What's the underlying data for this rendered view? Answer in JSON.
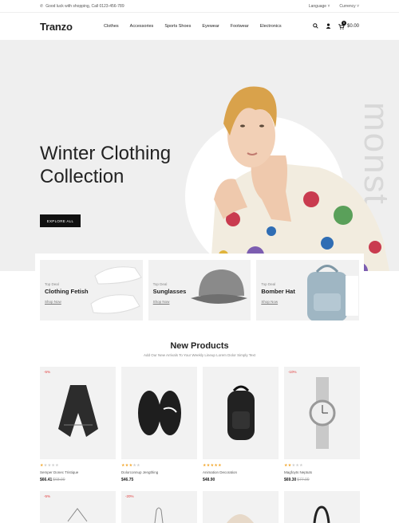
{
  "topbar": {
    "phone_icon": "phone-icon",
    "message": "Good luck with shopping, Call 0123-456-789",
    "language": "Language",
    "currency": "Currency"
  },
  "header": {
    "logo": "Tranzo",
    "nav": [
      "Clothes",
      "Accessories",
      "Sports Shoes",
      "Eyewear",
      "Footwear",
      "Electronics"
    ],
    "cart_total": "$0.00",
    "cart_count": "0"
  },
  "hero": {
    "title_line1": "Winter Clothing",
    "title_line2": "Collection",
    "button": "EXPLORE ALL",
    "vertical_text": "monst"
  },
  "promos": [
    {
      "tag": "Top Deal",
      "title": "Clothing Fetish",
      "link": "Shop Now"
    },
    {
      "tag": "Top Deal",
      "title": "Sunglasses",
      "link": "Shop Now"
    },
    {
      "tag": "Top Deal",
      "title": "Bomber Hat",
      "link": "Shop Now"
    }
  ],
  "new_products": {
    "title": "New Products",
    "subtitle": "Add Our New Arrivals To Your Weekly Lineup Lorem Dolor Simply Text"
  },
  "products": [
    {
      "badge": "-5%",
      "name": "Semper Donec Tristique",
      "price": "$66.41",
      "old_price": "$68.90",
      "rating": 1
    },
    {
      "badge": "",
      "name": "Dolorconnup Jengthing",
      "price": "$46.75",
      "old_price": "",
      "rating": 3
    },
    {
      "badge": "",
      "name": "Animation Decoration",
      "price": "$48.90",
      "old_price": "",
      "rating": 5
    },
    {
      "badge": "-10%",
      "name": "Magfoyts Neptuts",
      "price": "$69.30",
      "old_price": "$77.00",
      "rating": 2
    }
  ],
  "products_row2": [
    {
      "badge": "-5%"
    },
    {
      "badge": "-20%"
    },
    {
      "badge": ""
    },
    {
      "badge": ""
    }
  ]
}
